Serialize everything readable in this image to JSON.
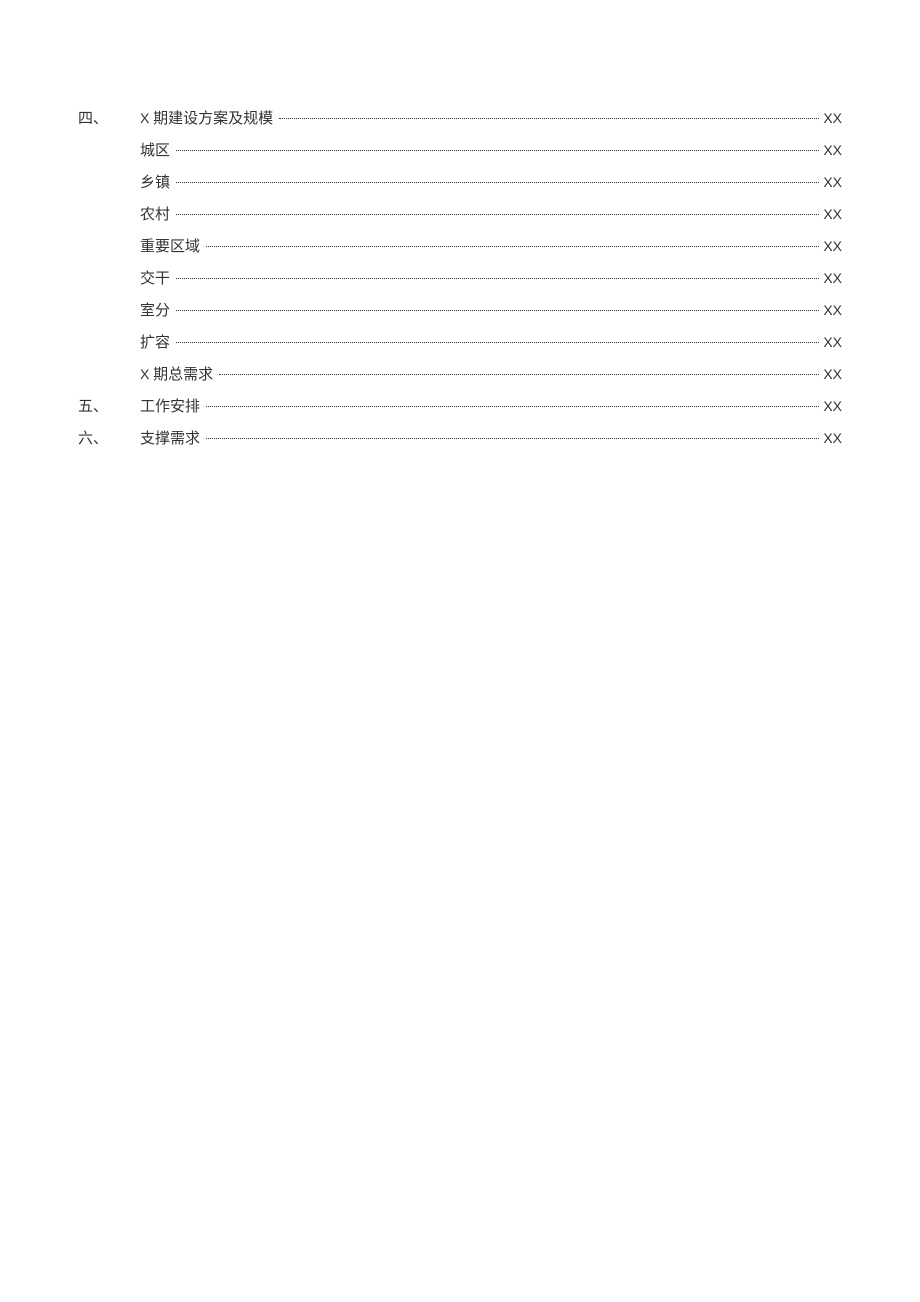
{
  "toc": [
    {
      "marker": "四、",
      "title_pre": "X",
      "title_rest": " 期建设方案及规模",
      "page": "XX",
      "level": 0
    },
    {
      "marker": "",
      "title_pre": "",
      "title_rest": "城区",
      "page": "XX",
      "level": 1
    },
    {
      "marker": "",
      "title_pre": "",
      "title_rest": "乡镇",
      "page": "XX",
      "level": 1
    },
    {
      "marker": "",
      "title_pre": "",
      "title_rest": "农村",
      "page": "XX",
      "level": 1
    },
    {
      "marker": "",
      "title_pre": "",
      "title_rest": "重要区域",
      "page": "XX",
      "level": 1
    },
    {
      "marker": "",
      "title_pre": "",
      "title_rest": "交干",
      "page": "XX",
      "level": 1
    },
    {
      "marker": "",
      "title_pre": "",
      "title_rest": "室分",
      "page": "XX",
      "level": 1
    },
    {
      "marker": "",
      "title_pre": "",
      "title_rest": "扩容",
      "page": "XX",
      "level": 1
    },
    {
      "marker": "",
      "title_pre": "X",
      "title_rest": " 期总需求",
      "page": "XX",
      "level": 1
    },
    {
      "marker": "五、",
      "title_pre": "",
      "title_rest": "工作安排",
      "page": "XX",
      "level": 0
    },
    {
      "marker": "六、",
      "title_pre": "",
      "title_rest": "支撑需求",
      "page": "XX",
      "level": 0
    }
  ]
}
